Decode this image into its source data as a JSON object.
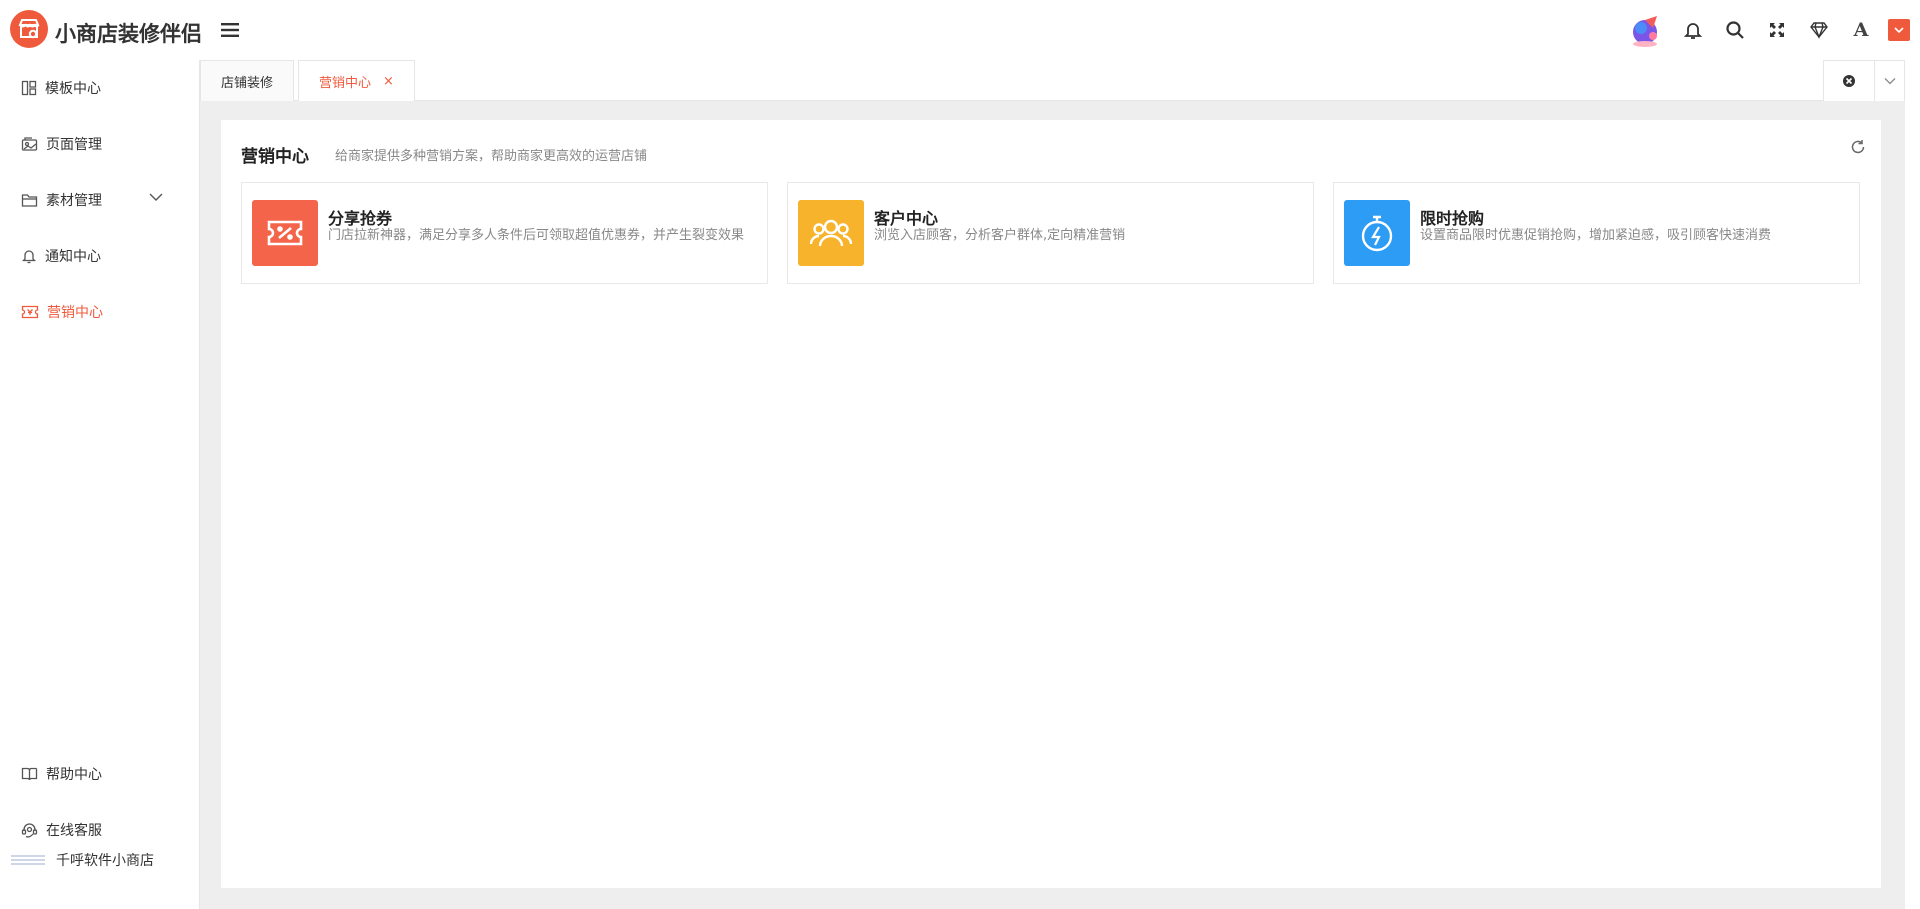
{
  "header": {
    "app_title": "小商店装修伴侣",
    "icons": [
      "logo-icon",
      "menu-icon",
      "promo-badge-icon",
      "bell-icon",
      "search-icon",
      "fullscreen-icon",
      "diamond-icon",
      "font-size-icon",
      "theme-swatch-icon"
    ],
    "font_label": "A",
    "theme_color": "#f05a3c"
  },
  "sidebar": {
    "items": [
      {
        "label": "模板中心",
        "icon": "layout-icon"
      },
      {
        "label": "页面管理",
        "icon": "page-icon"
      },
      {
        "label": "素材管理",
        "icon": "folder-icon",
        "expandable": true
      },
      {
        "label": "通知中心",
        "icon": "bell-icon"
      },
      {
        "label": "营销中心",
        "icon": "coupon-icon",
        "active": true
      },
      {
        "label": "帮助中心",
        "icon": "book-icon"
      },
      {
        "label": "在线客服",
        "icon": "headset-icon"
      }
    ],
    "shop_name": "千呼软件小商店"
  },
  "tabs": [
    {
      "label": "店铺装修",
      "active": false
    },
    {
      "label": "营销中心",
      "active": true,
      "close": "×"
    }
  ],
  "panel": {
    "title": "营销中心",
    "subtitle": "给商家提供多种营销方案，帮助商家更高效的运营店铺",
    "cards": [
      {
        "title": "分享抢券",
        "desc": "门店拉新神器，满足分享多人条件后可领取超值优惠券，并产生裂变效果",
        "color": "#f4644a",
        "icon": "ticket-icon"
      },
      {
        "title": "客户中心",
        "desc": "浏览入店顾客，分析客户群体,定向精准营销",
        "color": "#f7b32b",
        "icon": "users-icon"
      },
      {
        "title": "限时抢购",
        "desc": "设置商品限时优惠促销抢购，增加紧迫感，吸引顾客快速消费",
        "color": "#2d9cf5",
        "icon": "stopwatch-icon"
      }
    ]
  }
}
